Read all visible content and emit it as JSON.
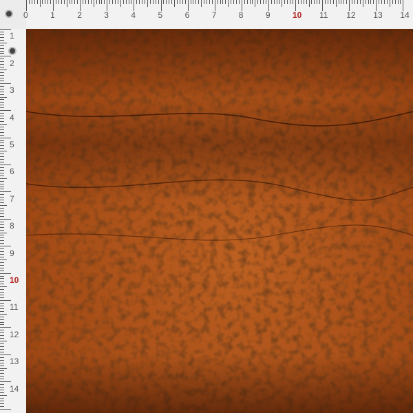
{
  "ruler": {
    "unit": "cm",
    "top_labels": [
      "0",
      "1",
      "2",
      "3",
      "4",
      "5",
      "6",
      "7",
      "8",
      "9",
      "10",
      "11",
      "12",
      "13",
      "14"
    ],
    "left_labels": [
      "1",
      "2",
      "3",
      "4",
      "5",
      "6",
      "7",
      "8",
      "9",
      "10",
      "11",
      "12",
      "13",
      "14"
    ],
    "accent_label": "10",
    "accent_color": "#b22222",
    "tick_color": "#555555"
  },
  "texture": {
    "subject": "leather-grain",
    "base_color": "#9a4312",
    "highlight_color": "#d9782f",
    "shadow_color": "#3a1404",
    "crease_color": "#2a0e02"
  }
}
